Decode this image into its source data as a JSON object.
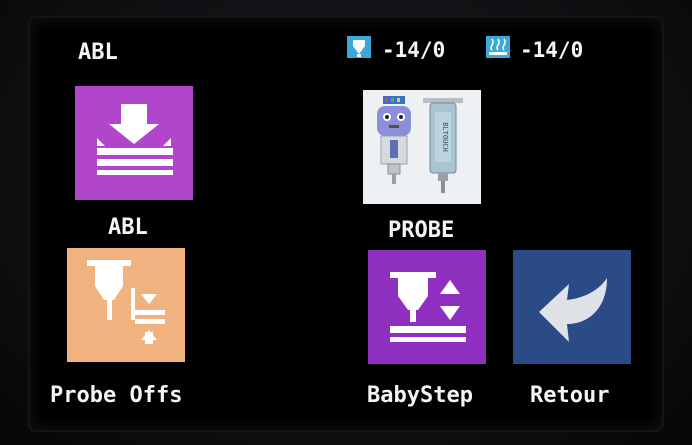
{
  "header": {
    "title": "ABL",
    "nozzle_icon": "nozzle-temperature-icon",
    "nozzle_temp": "-14/0",
    "bed_icon": "bed-temperature-icon",
    "bed_temp": "-14/0"
  },
  "menu": {
    "items": [
      {
        "label": "ABL",
        "icon": "bed-leveling-icon",
        "color": "#b046c9"
      },
      {
        "label": "PROBE",
        "icon": "bltouch-probe-icon",
        "color": "#eef1f3"
      },
      {
        "label": "Probe Offs",
        "icon": "probe-offset-icon",
        "color": "#f0b27f"
      },
      {
        "label": "BabyStep",
        "icon": "babystep-icon",
        "color": "#8f2fc0"
      },
      {
        "label": "Retour",
        "icon": "back-arrow-icon",
        "color": "#2b4b86"
      }
    ]
  },
  "colors": {
    "text": "#f4f4f4",
    "background": "#000000",
    "status_icon": "#3aa8d8"
  }
}
